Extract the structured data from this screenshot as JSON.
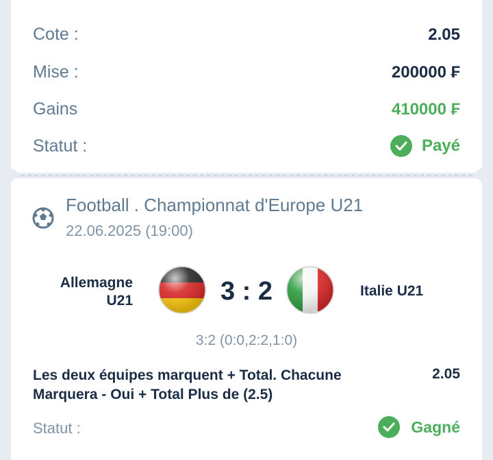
{
  "summary": {
    "cote_label": "Cote :",
    "cote_value": "2.05",
    "mise_label": "Mise :",
    "mise_value": "200000 ₣",
    "gains_label": "Gains",
    "gains_value": "410000 ₣",
    "statut_label": "Statut :",
    "statut_value": "Payé"
  },
  "event": {
    "league": "Football . Championnat d'Europe U21",
    "date": "22.06.2025 (19:00)",
    "home_team_line1": "Allemagne",
    "home_team_line2": "U21",
    "away_team": "Italie U21",
    "score": "3 : 2",
    "score_detail": "3:2 (0:0,2:2,1:0)",
    "bet_line1": "Les deux équipes marquent + Total. Chacune",
    "bet_line2": "Marquera - Oui + Total Plus de (2.5)",
    "bet_odds": "2.05",
    "status_label": "Statut :",
    "status_value": "Gagné"
  },
  "colors": {
    "accent_green": "#4cae5a",
    "text_dark": "#1b2d45",
    "text_muted": "#5f7a90"
  },
  "icons": {
    "sport": "football-icon",
    "status": "check-circle-icon",
    "home_flag": "germany-flag-icon",
    "away_flag": "italy-flag-icon"
  }
}
